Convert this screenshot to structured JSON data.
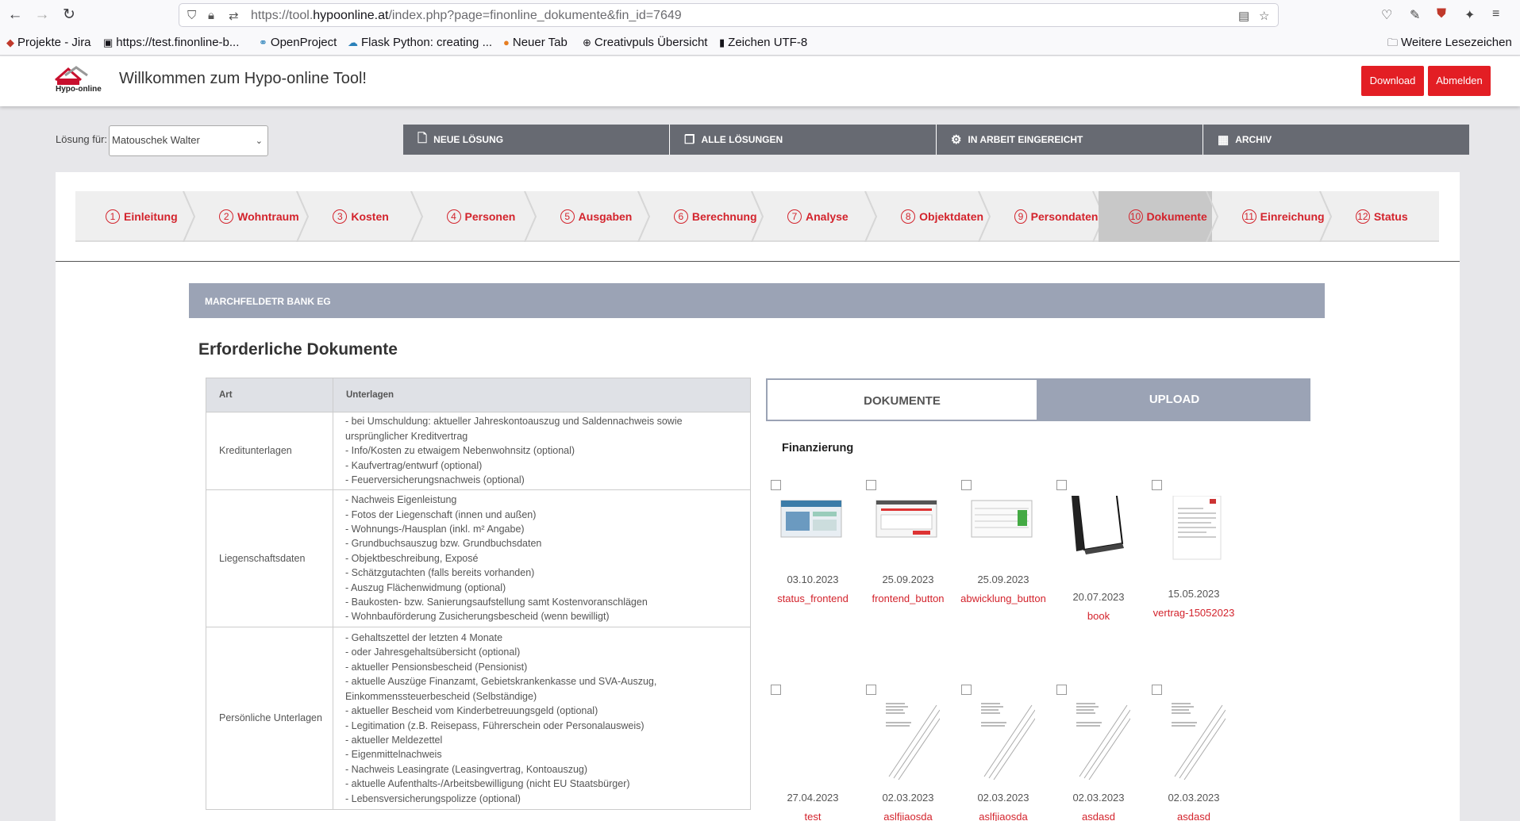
{
  "browser": {
    "url_prefix": "https://tool.",
    "url_domain": "hypoonline.at",
    "url_rest": "/index.php?page=finonline_dokumente&fin_id=7649",
    "bookmarks": [
      "Projekte - Jira",
      "https://test.finonline-b...",
      "OpenProject",
      "Flask Python: creating ...",
      "Neuer Tab",
      "Creativpuls Übersicht",
      "Zeichen UTF-8"
    ],
    "other_bookmarks": "Weitere Lesezeichen"
  },
  "header": {
    "logo_text": "Hypo-online",
    "welcome": "Willkommen zum Hypo-online Tool!",
    "download": "Download",
    "logout": "Abmelden"
  },
  "loesung": {
    "label": "Lösung für:",
    "selected": "Matouschek Walter"
  },
  "topnav": [
    "NEUE LÖSUNG",
    "ALLE LÖSUNGEN",
    "IN ARBEIT EINGEREICHT",
    "ARCHIV"
  ],
  "steps": [
    {
      "num": "1",
      "label": "Einleitung"
    },
    {
      "num": "2",
      "label": "Wohntraum"
    },
    {
      "num": "3",
      "label": "Kosten"
    },
    {
      "num": "4",
      "label": "Personen"
    },
    {
      "num": "5",
      "label": "Ausgaben"
    },
    {
      "num": "6",
      "label": "Berechnung"
    },
    {
      "num": "7",
      "label": "Analyse"
    },
    {
      "num": "8",
      "label": "Objektdaten"
    },
    {
      "num": "9",
      "label": "Persondaten"
    },
    {
      "num": "10",
      "label": "Dokumente"
    },
    {
      "num": "11",
      "label": "Einreichung"
    },
    {
      "num": "12",
      "label": "Status"
    }
  ],
  "active_step": "10",
  "bank": "MARCHFELDETR BANK EG",
  "doc_title": "Erforderliche Dokumente",
  "table": {
    "headers": [
      "Art",
      "Unterlagen"
    ],
    "rows": [
      {
        "art": "Kreditunterlagen",
        "items": [
          "- bei Umschuldung: aktueller Jahreskontoauszug und Saldennachweis sowie ursprünglicher Kreditvertrag",
          "- Info/Kosten zu etwaigem Nebenwohnsitz (optional)",
          "- Kaufvertrag/entwurf (optional)",
          "- Feuerversicherungsnachweis (optional)"
        ]
      },
      {
        "art": "Liegenschaftsdaten",
        "items": [
          "- Nachweis Eigenleistung",
          "- Fotos der Liegenschaft (innen und außen)",
          "- Wohnungs-/Hausplan (inkl. m² Angabe)",
          "- Grundbuchsauszug bzw. Grundbuchsdaten",
          "- Objektbeschreibung, Exposé",
          "- Schätzgutachten (falls bereits vorhanden)",
          "- Auszug Flächenwidmung (optional)",
          "- Baukosten- bzw. Sanierungsaufstellung samt Kostenvoranschlägen",
          "- Wohnbauförderung Zusicherungsbescheid (wenn bewilligt)"
        ]
      },
      {
        "art": "Persönliche Unterlagen",
        "items": [
          "- Gehaltszettel der letzten 4 Monate",
          "- oder Jahresgehaltsübersicht (optional)",
          "- aktueller Pensionsbescheid (Pensionist)",
          "- aktuelle Auszüge Finanzamt, Gebietskrankenkasse und SVA-Auszug, Einkommenssteuerbescheid (Selbständige)",
          "- aktueller Bescheid vom Kinderbetreuungsgeld (optional)",
          "- Legitimation (z.B. Reisepass, Führerschein oder Personalausweis)",
          "- aktueller Meldezettel",
          "- Eigenmittelnachweis",
          "- Nachweis Leasingrate (Leasingvertrag, Kontoauszug)",
          "- aktuelle Aufenthalts-/Arbeitsbewilligung (nicht EU Staatsbürger)",
          "- Lebensversicherungspolizze (optional)"
        ]
      }
    ]
  },
  "tabs": {
    "dokumente": "DOKUMENTE",
    "upload": "UPLOAD"
  },
  "finanzierung": "Finanzierung",
  "files": [
    {
      "date": "03.10.2023",
      "name": "status_frontend",
      "kind": "screenshot-blue"
    },
    {
      "date": "25.09.2023",
      "name": "frontend_button",
      "kind": "screenshot-red"
    },
    {
      "date": "25.09.2023",
      "name": "abwicklung_button",
      "kind": "screenshot-table"
    },
    {
      "date": "20.07.2023",
      "name": "book",
      "kind": "book"
    },
    {
      "date": "15.05.2023",
      "name": "vertrag-15052023",
      "kind": "document"
    },
    {
      "date": "27.04.2023",
      "name": "test",
      "kind": "blank"
    },
    {
      "date": "02.03.2023",
      "name": "aslfjiaosda",
      "kind": "letter"
    },
    {
      "date": "02.03.2023",
      "name": "aslfjiaosda",
      "kind": "letter"
    },
    {
      "date": "02.03.2023",
      "name": "asdasd",
      "kind": "letter"
    },
    {
      "date": "02.03.2023",
      "name": "asdasd",
      "kind": "letter"
    }
  ],
  "colors": {
    "brand_red": "#e31e24",
    "nav_gray": "#676a72",
    "bank_bar": "#9ba3b5"
  }
}
